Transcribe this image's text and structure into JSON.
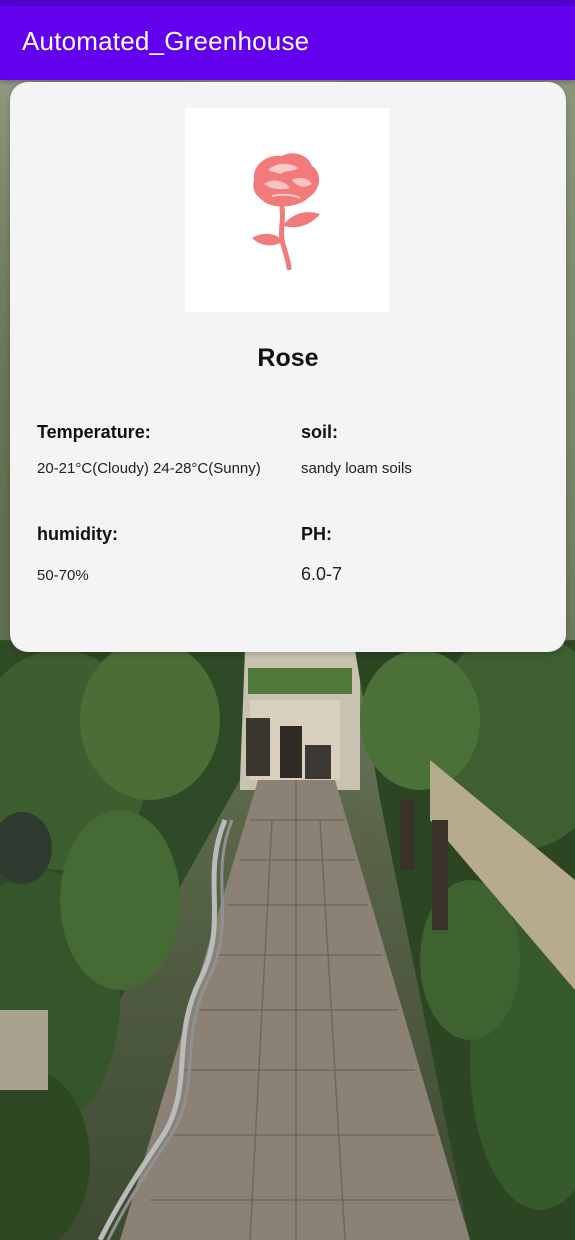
{
  "app": {
    "title": "Automated_Greenhouse",
    "accent_color": "#6200ee"
  },
  "plant": {
    "name": "Rose",
    "image_icon": "rose-icon",
    "image_color": "#f27a7a"
  },
  "fields": {
    "temperature": {
      "label": "Temperature:",
      "value": "20-21°C(Cloudy) 24-28°C(Sunny)"
    },
    "soil": {
      "label": "soil:",
      "value": "sandy loam soils"
    },
    "humidity": {
      "label": "humidity:",
      "value": "50-70%"
    },
    "ph": {
      "label": "PH:",
      "value": "6.0-7"
    }
  }
}
